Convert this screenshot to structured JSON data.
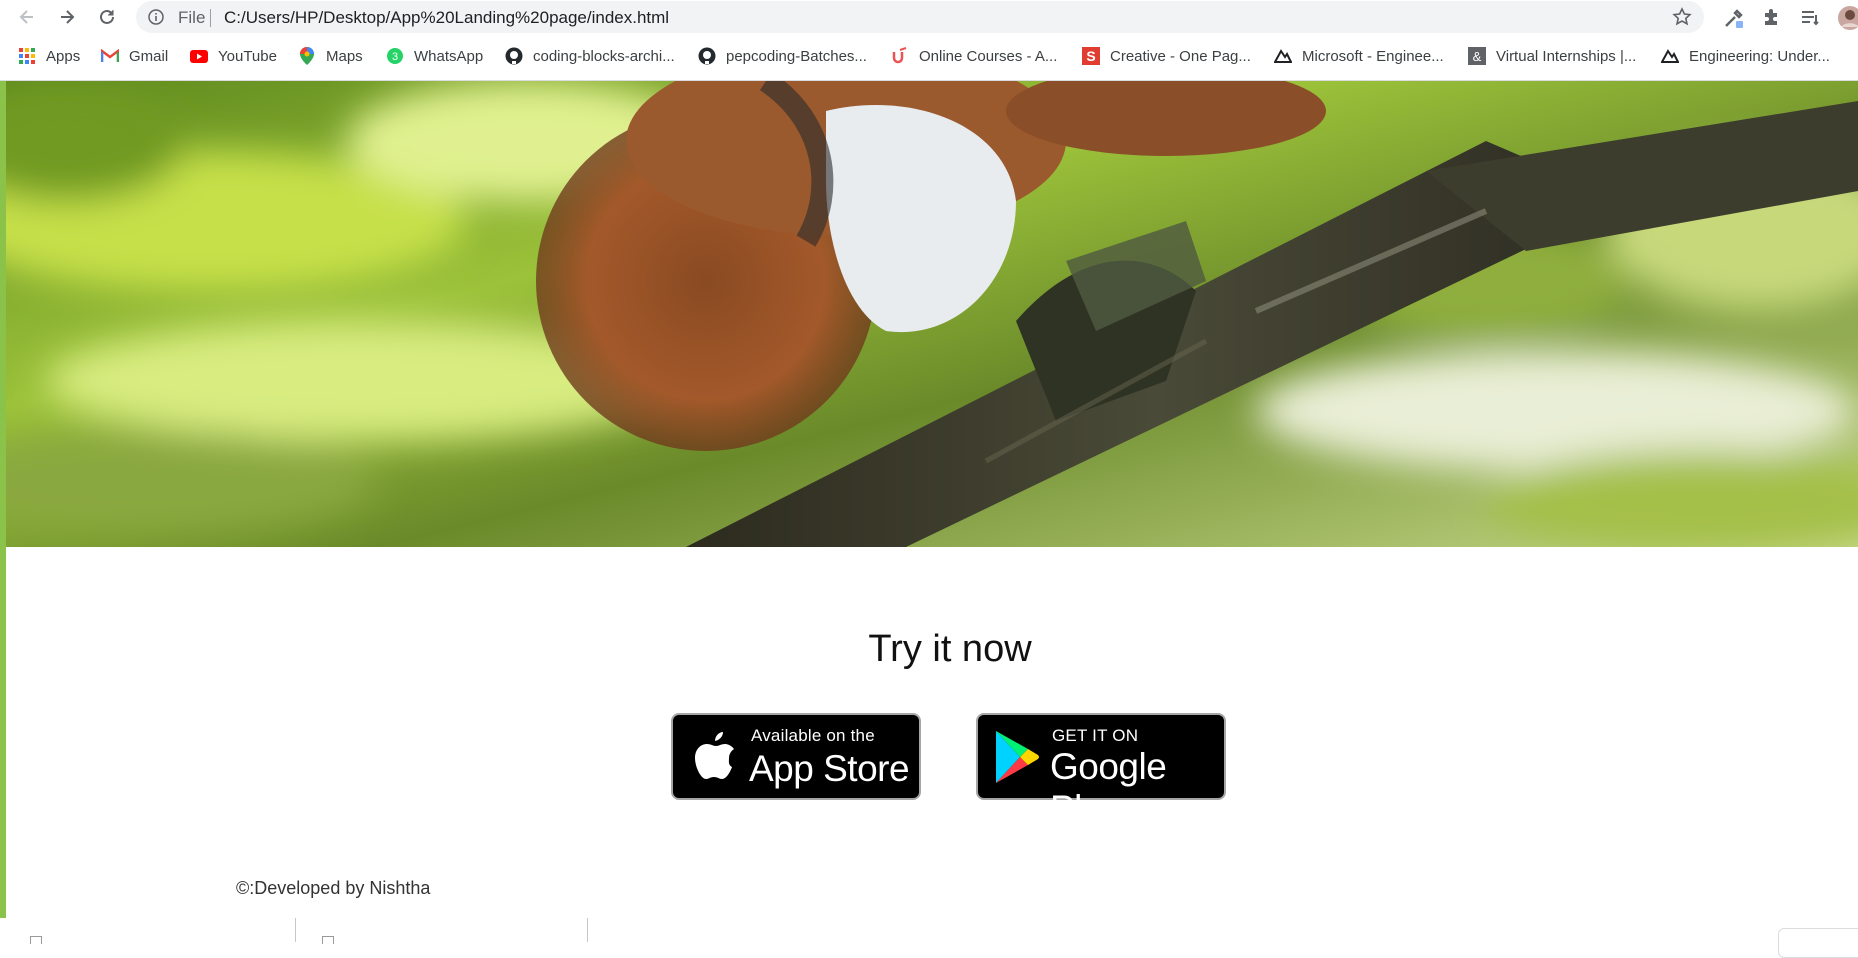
{
  "browser": {
    "omnibox": {
      "scheme_label": "File",
      "url": "C:/Users/HP/Desktop/App%20Landing%20page/index.html"
    },
    "bookmarks": [
      {
        "label": "Apps",
        "icon": "apps-grid-icon"
      },
      {
        "label": "Gmail",
        "icon": "gmail-icon"
      },
      {
        "label": "YouTube",
        "icon": "youtube-icon"
      },
      {
        "label": "Maps",
        "icon": "maps-pin-icon"
      },
      {
        "label": "WhatsApp",
        "icon": "whatsapp-icon"
      },
      {
        "label": "coding-blocks-archi...",
        "icon": "github-icon"
      },
      {
        "label": "pepcoding-Batches...",
        "icon": "github-icon"
      },
      {
        "label": "Online Courses - A...",
        "icon": "udemy-icon"
      },
      {
        "label": "Creative - One Pag...",
        "icon": "s-logo-icon"
      },
      {
        "label": "Microsoft - Enginee...",
        "icon": "mountain-icon"
      },
      {
        "label": "Virtual Internships |...",
        "icon": "ampersand-icon"
      },
      {
        "label": "Engineering: Under...",
        "icon": "mountain-icon"
      }
    ],
    "whatsapp_badge": "3"
  },
  "page": {
    "hero": {
      "description_icon": "squirrel-photo"
    },
    "cta_heading": "Try it now",
    "app_store": {
      "small": "Available on the",
      "big": "App Store"
    },
    "google_play": {
      "small": "GET IT ON",
      "big": "Google Play"
    },
    "footer": "©:Developed by Nishtha"
  },
  "colors": {
    "accent": "#8bc34a",
    "badge_bg": "#000000",
    "chrome_bg": "#f1f3f4"
  }
}
